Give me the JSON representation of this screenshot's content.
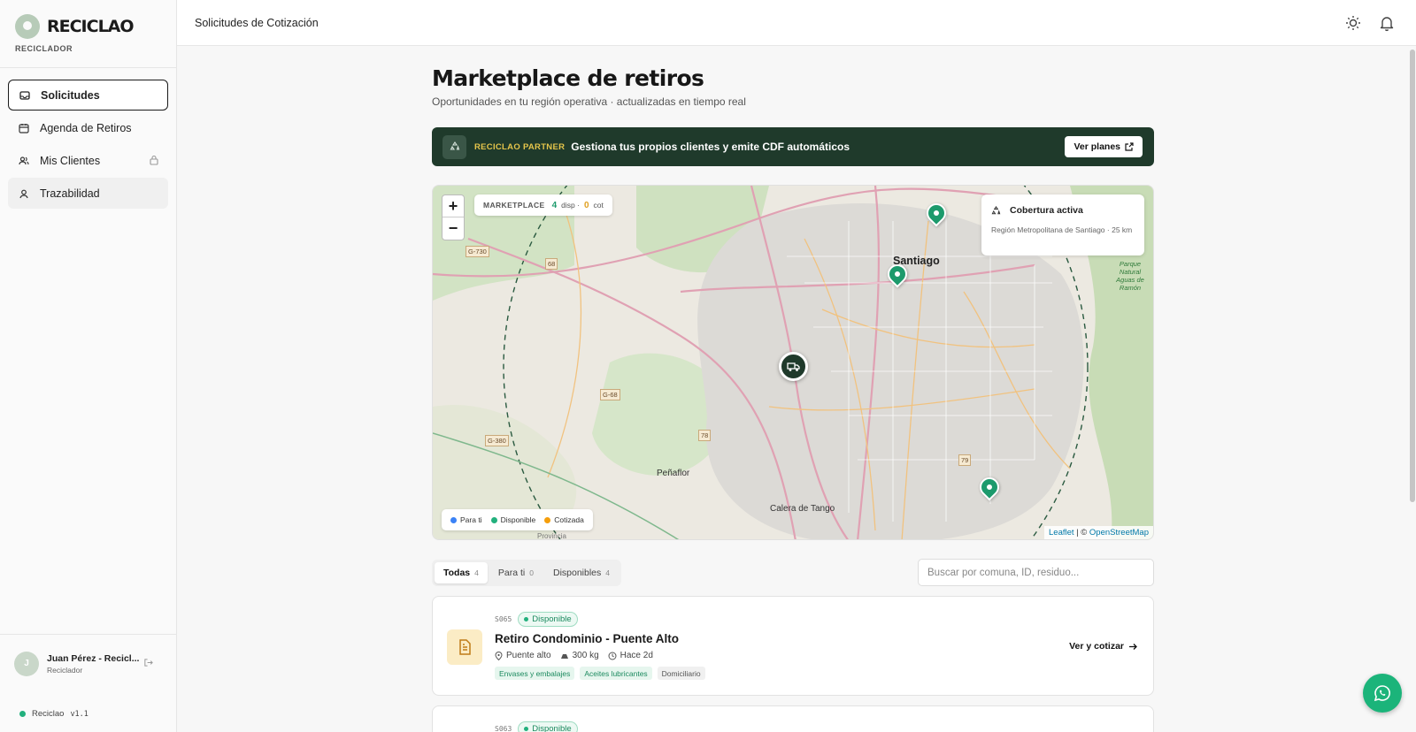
{
  "brand": {
    "name": "RECICLAO",
    "role": "RECICLADOR"
  },
  "sidebar": {
    "items": [
      {
        "label": "Solicitudes",
        "icon": "inbox-icon",
        "active": true
      },
      {
        "label": "Agenda de Retiros",
        "icon": "calendar-icon"
      },
      {
        "label": "Mis Clientes",
        "icon": "users-icon",
        "locked": true
      },
      {
        "label": "Trazabilidad",
        "icon": "location-person-icon"
      }
    ],
    "user": {
      "initial": "J",
      "name": "Juan Pérez - Recicl...",
      "role": "Reciclador"
    },
    "version_label": "Reciclao",
    "version": "v1.1"
  },
  "header": {
    "title": "Solicitudes de Cotización"
  },
  "main": {
    "title": "Marketplace de retiros",
    "subtitle": "Oportunidades en tu región operativa · actualizadas en tiempo real"
  },
  "banner": {
    "tag": "RECICLAO PARTNER",
    "text": "Gestiona tus propios clientes y emite CDF automáticos",
    "button": "Ver planes"
  },
  "map": {
    "marketplace_label": "MARKETPLACE",
    "available_count": "4",
    "available_suffix": "disp ·",
    "quoted_count": "0",
    "quoted_suffix": "cot",
    "coverage_title": "Cobertura activa",
    "coverage_sub": "Región Metropolitana de Santiago · 25 km",
    "legend": [
      {
        "label": "Para ti",
        "color": "#3b82f6"
      },
      {
        "label": "Disponible",
        "color": "#22b07d"
      },
      {
        "label": "Cotizada",
        "color": "#f59e0b"
      }
    ],
    "place_labels": {
      "santiago": "Santiago",
      "penaflor": "Peñaflor",
      "calera": "Calera de Tango",
      "park": "Parque Natural Aguas de Ramón",
      "provincia": "Provincia"
    },
    "road_labels": [
      "G-730",
      "68",
      "G-68",
      "G-380",
      "78",
      "79"
    ],
    "attribution_leaflet": "Leaflet",
    "attribution_sep": " | © ",
    "attribution_osm": "OpenStreetMap"
  },
  "filters": {
    "tabs": [
      {
        "label": "Todas",
        "count": "4",
        "active": true
      },
      {
        "label": "Para ti",
        "count": "0"
      },
      {
        "label": "Disponibles",
        "count": "4"
      }
    ],
    "search_placeholder": "Buscar por comuna, ID, residuo..."
  },
  "requests": [
    {
      "id": "S065",
      "status": "Disponible",
      "title": "Retiro Condominio - Puente Alto",
      "location": "Puente alto",
      "weight": "300 kg",
      "age": "Hace 2d",
      "tags": [
        "Envases y embalajes",
        "Aceites lubricantes",
        "Domiciliario"
      ],
      "cta": "Ver y cotizar"
    },
    {
      "id": "S063",
      "status": "Disponible"
    }
  ]
}
